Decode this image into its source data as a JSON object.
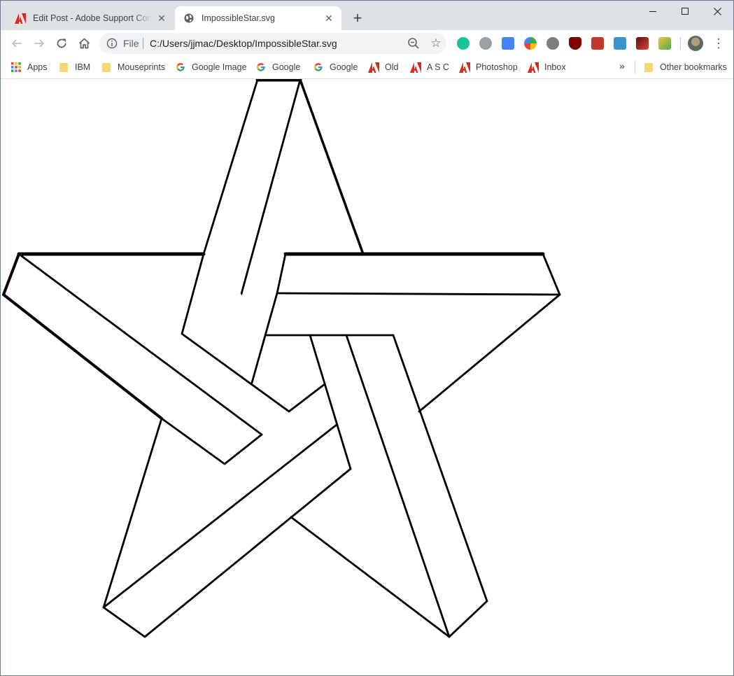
{
  "browser": {
    "tabs": [
      {
        "title": "Edit Post - Adobe Support Community",
        "favicon": "adobe-icon",
        "active": false
      },
      {
        "title": "ImpossibleStar.svg",
        "favicon": "globe-icon",
        "active": true
      }
    ],
    "new_tab_glyph": "+",
    "address": {
      "scheme_label": "File",
      "url": "C:/Users/jjmac/Desktop/ImpossibleStar.svg"
    },
    "bookmarks": [
      {
        "label": "Apps",
        "icon": "apps-grid-icon"
      },
      {
        "label": "IBM",
        "icon": "folder-icon"
      },
      {
        "label": "Mouseprints",
        "icon": "folder-icon"
      },
      {
        "label": "Google Image",
        "icon": "google-icon"
      },
      {
        "label": "Google",
        "icon": "google-icon"
      },
      {
        "label": "Google",
        "icon": "google-icon"
      },
      {
        "label": "Old",
        "icon": "adobe-icon"
      },
      {
        "label": "A S C",
        "icon": "adobe-icon"
      },
      {
        "label": "Photoshop",
        "icon": "adobe-icon"
      },
      {
        "label": "Inbox",
        "icon": "adobe-icon"
      }
    ],
    "overflow_glyph": "»",
    "other_bookmarks": "Other bookmarks"
  },
  "colors": {
    "tabstrip": "#dee1e6",
    "adobe_red": "#e1251b",
    "grammarly_green": "#15c39a",
    "ublock_red": "#800000",
    "folder_yellow": "#f6d776"
  },
  "content": {
    "image": "impossible-star-svg"
  }
}
